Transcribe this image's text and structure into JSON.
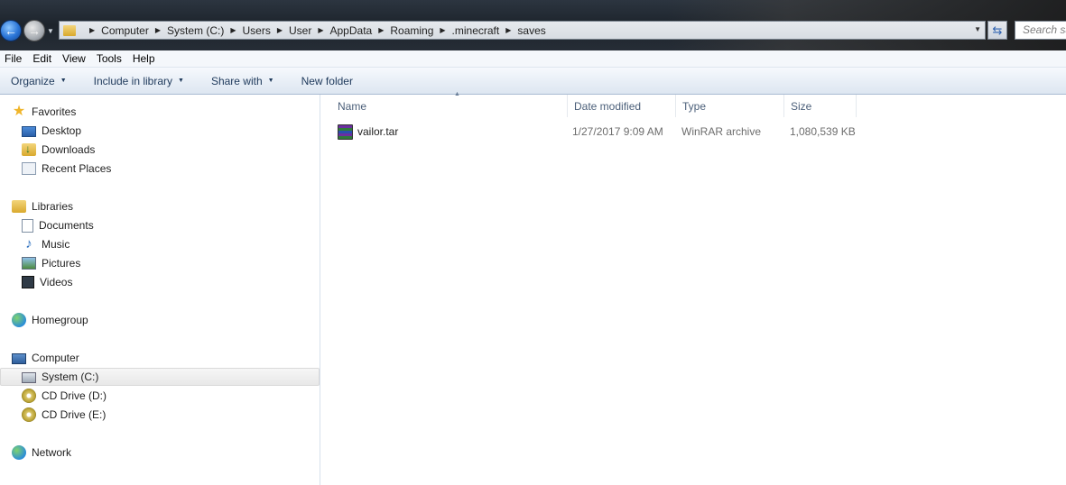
{
  "address": {
    "crumbs": [
      "Computer",
      "System (C:)",
      "Users",
      "User",
      "AppData",
      "Roaming",
      ".minecraft",
      "saves"
    ],
    "search_placeholder": "Search saves"
  },
  "menu": [
    "File",
    "Edit",
    "View",
    "Tools",
    "Help"
  ],
  "commands": {
    "organize": "Organize",
    "include_in_library": "Include in library",
    "share_with": "Share with",
    "new_folder": "New folder"
  },
  "nav": {
    "favorites": "Favorites",
    "desktop": "Desktop",
    "downloads": "Downloads",
    "recent_places": "Recent Places",
    "libraries": "Libraries",
    "documents": "Documents",
    "music": "Music",
    "pictures": "Pictures",
    "videos": "Videos",
    "homegroup": "Homegroup",
    "computer": "Computer",
    "system_c": "System (C:)",
    "cd_d": "CD Drive (D:)",
    "cd_e": "CD Drive (E:)",
    "network": "Network"
  },
  "columns": {
    "name": "Name",
    "date_modified": "Date modified",
    "type": "Type",
    "size": "Size"
  },
  "files": [
    {
      "name": "vailor.tar",
      "date_modified": "1/27/2017 9:09 AM",
      "type": "WinRAR archive",
      "size": "1,080,539 KB"
    }
  ]
}
